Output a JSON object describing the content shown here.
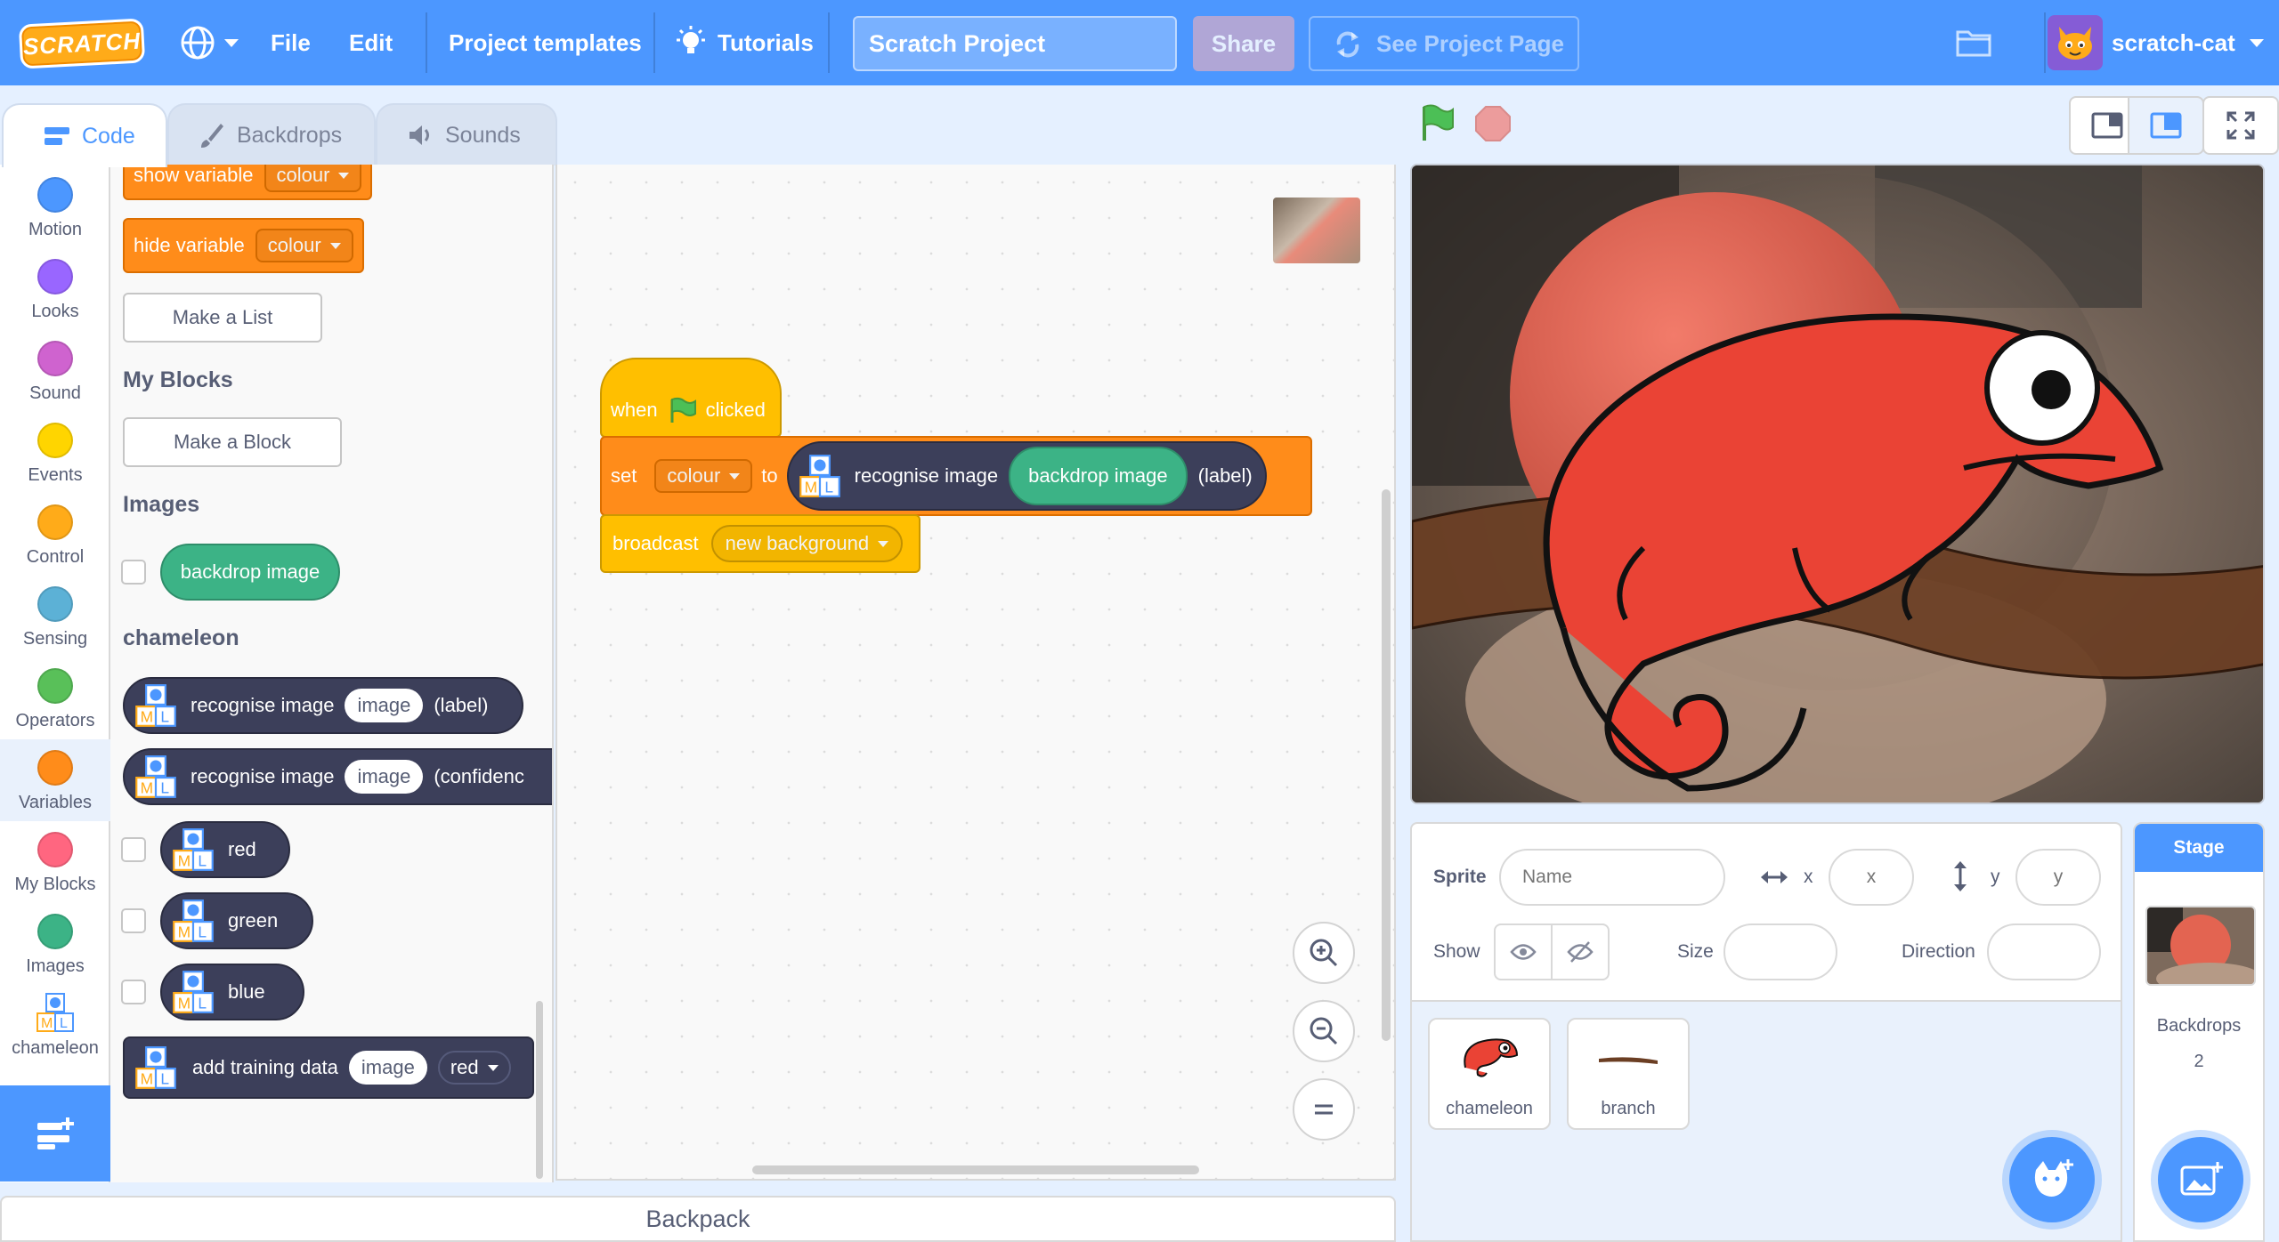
{
  "menubar": {
    "logo": "SCRATCH",
    "file": "File",
    "edit": "Edit",
    "project_templates": "Project templates",
    "tutorials": "Tutorials",
    "project_title": "Scratch Project",
    "share": "Share",
    "see_project_page": "See Project Page",
    "username": "scratch-cat"
  },
  "tabs": {
    "code": "Code",
    "backdrops": "Backdrops",
    "sounds": "Sounds"
  },
  "categories": [
    {
      "label": "Motion",
      "color": "#4c97ff"
    },
    {
      "label": "Looks",
      "color": "#9966ff"
    },
    {
      "label": "Sound",
      "color": "#cf63cf"
    },
    {
      "label": "Events",
      "color": "#ffd500"
    },
    {
      "label": "Control",
      "color": "#ffab19"
    },
    {
      "label": "Sensing",
      "color": "#5cb1d6"
    },
    {
      "label": "Operators",
      "color": "#59c059"
    },
    {
      "label": "Variables",
      "color": "#ff8c1a"
    },
    {
      "label": "My Blocks",
      "color": "#ff6680"
    },
    {
      "label": "Images",
      "color": "#3cb386"
    },
    {
      "label": "chameleon",
      "color": "#3c3f5a"
    }
  ],
  "palette": {
    "show_variable": "show variable",
    "hide_variable": "hide variable",
    "colour": "colour",
    "make_a_list": "Make a List",
    "my_blocks_heading": "My Blocks",
    "make_a_block": "Make a Block",
    "images_heading": "Images",
    "backdrop_image": "backdrop image",
    "chameleon_heading": "chameleon",
    "recognise_image": "recognise image",
    "image": "image",
    "label_suffix": "(label)",
    "confidence_suffix": "(confidenc",
    "red": "red",
    "green": "green",
    "blue": "blue",
    "add_training_data": "add training data"
  },
  "script": {
    "when": "when",
    "clicked": "clicked",
    "set": "set",
    "colour": "colour",
    "to": "to",
    "recognise_image": "recognise image",
    "backdrop_image": "backdrop image",
    "label": "(label)",
    "broadcast": "broadcast",
    "message": "new background"
  },
  "backpack": "Backpack",
  "sprite_info": {
    "sprite": "Sprite",
    "name_placeholder": "Name",
    "x_label": "x",
    "x_placeholder": "x",
    "y_label": "y",
    "y_placeholder": "y",
    "show": "Show",
    "size": "Size",
    "direction": "Direction"
  },
  "sprites": [
    {
      "name": "chameleon"
    },
    {
      "name": "branch"
    }
  ],
  "stage_panel": {
    "title": "Stage",
    "backdrops_label": "Backdrops",
    "backdrops_count": "2"
  }
}
